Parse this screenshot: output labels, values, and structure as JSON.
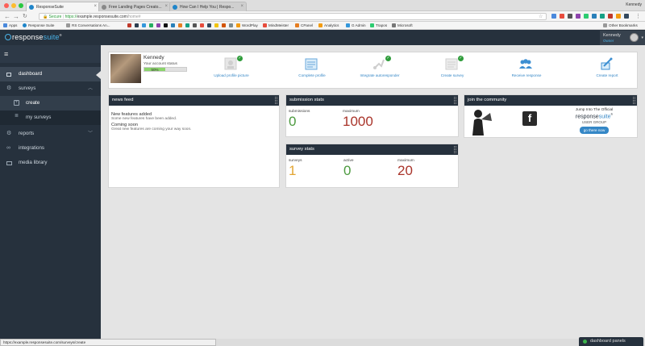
{
  "browser": {
    "profile_name": "Kennedy",
    "tabs": [
      {
        "label": "ResponseSuite"
      },
      {
        "label": "Free Landing Pages Creato..."
      },
      {
        "label": "How Can I Help You | Respo..."
      }
    ],
    "secure_label": "Secure",
    "url_scheme": "https://",
    "url_host": "example.responsesuite.com",
    "url_path": "/home#",
    "bookmarks": [
      "Apps",
      "Response Suite",
      "RS Conversations An...",
      "WordPlay",
      "MindMeister",
      "CPanel",
      "Analytics",
      "G Admin",
      "Trapos",
      "Microsoft",
      "Other Bookmarks"
    ],
    "status_url": "https://example.responsesuite.com/surveys/create"
  },
  "app": {
    "logo_prefix": "response",
    "logo_suffix": "suite",
    "user_name": "Kennedy",
    "user_role": "Owner",
    "dashboard_panel_label": "dashboard panels"
  },
  "sidebar": {
    "items": [
      {
        "label": "dashboard"
      },
      {
        "label": "surveys"
      },
      {
        "label": "create"
      },
      {
        "label": "my surveys"
      },
      {
        "label": "reports"
      },
      {
        "label": "integrations"
      },
      {
        "label": "media library"
      }
    ]
  },
  "profile": {
    "name": "Kennedy",
    "status_label": "Your account status",
    "progress_text": "50%",
    "progress_value": 0.5
  },
  "steps": [
    {
      "label": "Upload profile picture",
      "done": true
    },
    {
      "label": "Complete profile",
      "done": false
    },
    {
      "label": "Integrate autoresponder",
      "done": true
    },
    {
      "label": "Create survey",
      "done": true
    },
    {
      "label": "Receive response",
      "done": false
    },
    {
      "label": "Create report",
      "done": false
    }
  ],
  "news_feed": {
    "title": "news feed",
    "items": [
      {
        "title": "New features added",
        "sub": "Some new features have been added."
      },
      {
        "title": "Coming soon",
        "sub": "Great new features are coming your way soon."
      }
    ]
  },
  "submission_stats": {
    "title": "submission stats",
    "cols": [
      {
        "label": "submissions",
        "value": "0",
        "color": "#4c9a3f"
      },
      {
        "label": "maximum",
        "value": "1000",
        "color": "#a9342a"
      }
    ]
  },
  "survey_stats": {
    "title": "survey stats",
    "cols": [
      {
        "label": "surveys",
        "value": "1",
        "color": "#e2a533"
      },
      {
        "label": "active",
        "value": "0",
        "color": "#4c9a3f"
      },
      {
        "label": "maximum",
        "value": "20",
        "color": "#a9342a"
      }
    ]
  },
  "community": {
    "title": "join the community",
    "jump_text": "Jump Into The Official",
    "logo_prefix": "response",
    "logo_suffix": "suite",
    "group_text": "USER GROUP",
    "button_label": "go there now"
  }
}
